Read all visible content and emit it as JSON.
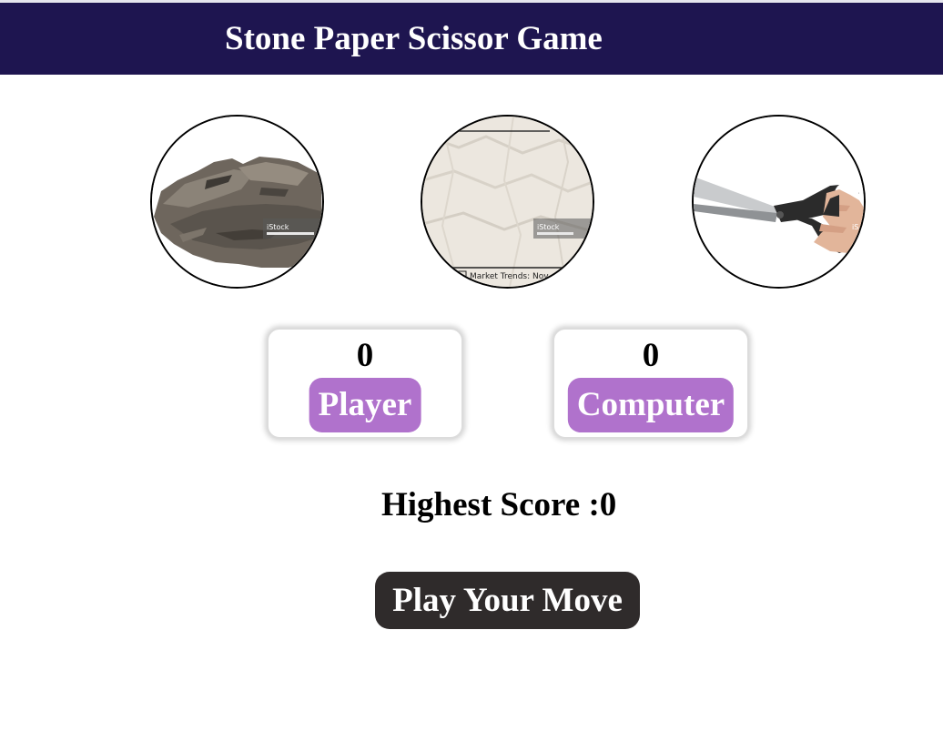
{
  "header": {
    "title": "Stone Paper Scissor Game"
  },
  "choices": [
    {
      "name": "stone",
      "icon": "stone-image",
      "watermark": "iStock"
    },
    {
      "name": "paper",
      "icon": "paper-image",
      "watermark": "iStock",
      "caption": "Market Trends: Nov"
    },
    {
      "name": "scissor",
      "icon": "scissor-image",
      "watermark": "iS"
    }
  ],
  "scores": {
    "player": {
      "value": "0",
      "label": "Player"
    },
    "computer": {
      "value": "0",
      "label": "Computer"
    }
  },
  "highest_score": "Highest Score :0",
  "play_button": {
    "label": "Play Your Move"
  },
  "colors": {
    "header": "#1e1550",
    "label_badge": "#b072cc",
    "button": "#2f2b2b"
  }
}
